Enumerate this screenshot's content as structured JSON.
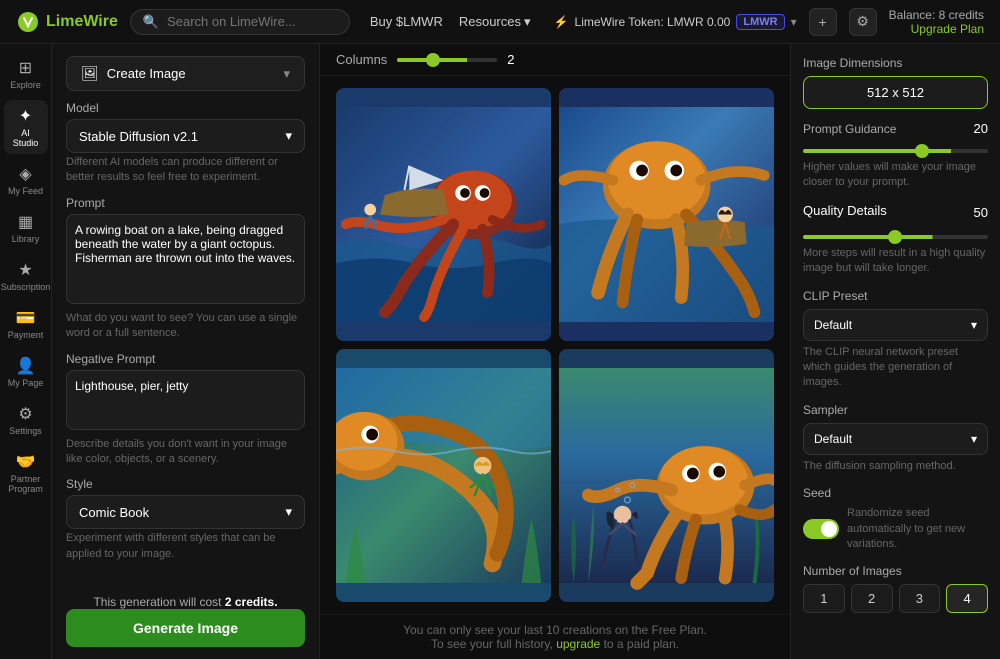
{
  "topnav": {
    "logo": "LimeWire",
    "search_placeholder": "Search on LimeWire...",
    "buy_label": "Buy $LMWR",
    "resources_label": "Resources",
    "resources_chevron": "▾",
    "token_label": "LimeWire Token: LMWR 0.00",
    "lmwr_badge": "LMWR",
    "balance_label": "Balance: 8 credits",
    "upgrade_label": "Upgrade Plan"
  },
  "icon_nav": {
    "items": [
      {
        "id": "explore",
        "icon": "⊞",
        "label": "Explore"
      },
      {
        "id": "ai-studio",
        "icon": "✦",
        "label": "AI Studio"
      },
      {
        "id": "my-feed",
        "icon": "◈",
        "label": "My Feed"
      },
      {
        "id": "library",
        "icon": "▦",
        "label": "Library"
      },
      {
        "id": "subscription",
        "icon": "★",
        "label": "Subscription"
      },
      {
        "id": "payment",
        "icon": "💳",
        "label": "Payment"
      },
      {
        "id": "my-page",
        "icon": "👤",
        "label": "My Page"
      },
      {
        "id": "settings",
        "icon": "⚙",
        "label": "Settings"
      },
      {
        "id": "partner",
        "icon": "🤝",
        "label": "Partner Program"
      }
    ]
  },
  "left_panel": {
    "create_btn_label": "Create Image",
    "model_label": "Model",
    "model_value": "Stable Diffusion v2.1",
    "model_hint": "Different AI models can produce different or better results so feel free to experiment.",
    "prompt_label": "Prompt",
    "prompt_value": "A rowing boat on a lake, being dragged beneath the water by a giant octopus. Fisherman are thrown out into the waves.",
    "prompt_placeholder": "",
    "prompt_hint": "What do you want to see? You can use a single word or a full sentence.",
    "neg_prompt_label": "Negative Prompt",
    "neg_prompt_value": "Lighthouse, pier, jetty",
    "neg_prompt_hint": "Describe details you don't want in your image like color, objects, or a scenery.",
    "style_label": "Style",
    "style_value": "Comic Book",
    "style_hint": "Experiment with different styles that can be applied to your image.",
    "cost_text": "This generation will cost",
    "cost_credits": "2 credits.",
    "generate_label": "Generate Image"
  },
  "columns_bar": {
    "label": "Columns",
    "value": "2",
    "slider_percent": 70
  },
  "bottom_notice": {
    "text1": "You can only see your last 10 creations on the Free Plan.",
    "text2": "To see your full history,",
    "link": "upgrade",
    "text3": "to a paid plan."
  },
  "right_panel": {
    "dimensions_label": "Image Dimensions",
    "dimension_value": "512 x 512",
    "prompt_guidance_label": "Prompt Guidance",
    "prompt_guidance_value": "20",
    "prompt_guidance_hint": "Higher values will make your image closer to your prompt.",
    "quality_label": "Quality & Details",
    "quality_details_label": "Quality Details",
    "quality_value": "50",
    "quality_hint": "More steps will result in a high quality image but will take longer.",
    "clip_preset_label": "CLIP Preset",
    "clip_preset_value": "Default",
    "clip_preset_hint": "The CLIP neural network preset which guides the generation of images.",
    "sampler_label": "Sampler",
    "sampler_value": "Default",
    "sampler_hint": "The diffusion sampling method.",
    "seed_label": "Seed",
    "seed_toggle": true,
    "seed_hint": "Randomize seed automatically to get new variations.",
    "num_images_label": "Number of Images",
    "num_images_options": [
      "1",
      "2",
      "3",
      "4"
    ],
    "num_images_active": 3
  }
}
